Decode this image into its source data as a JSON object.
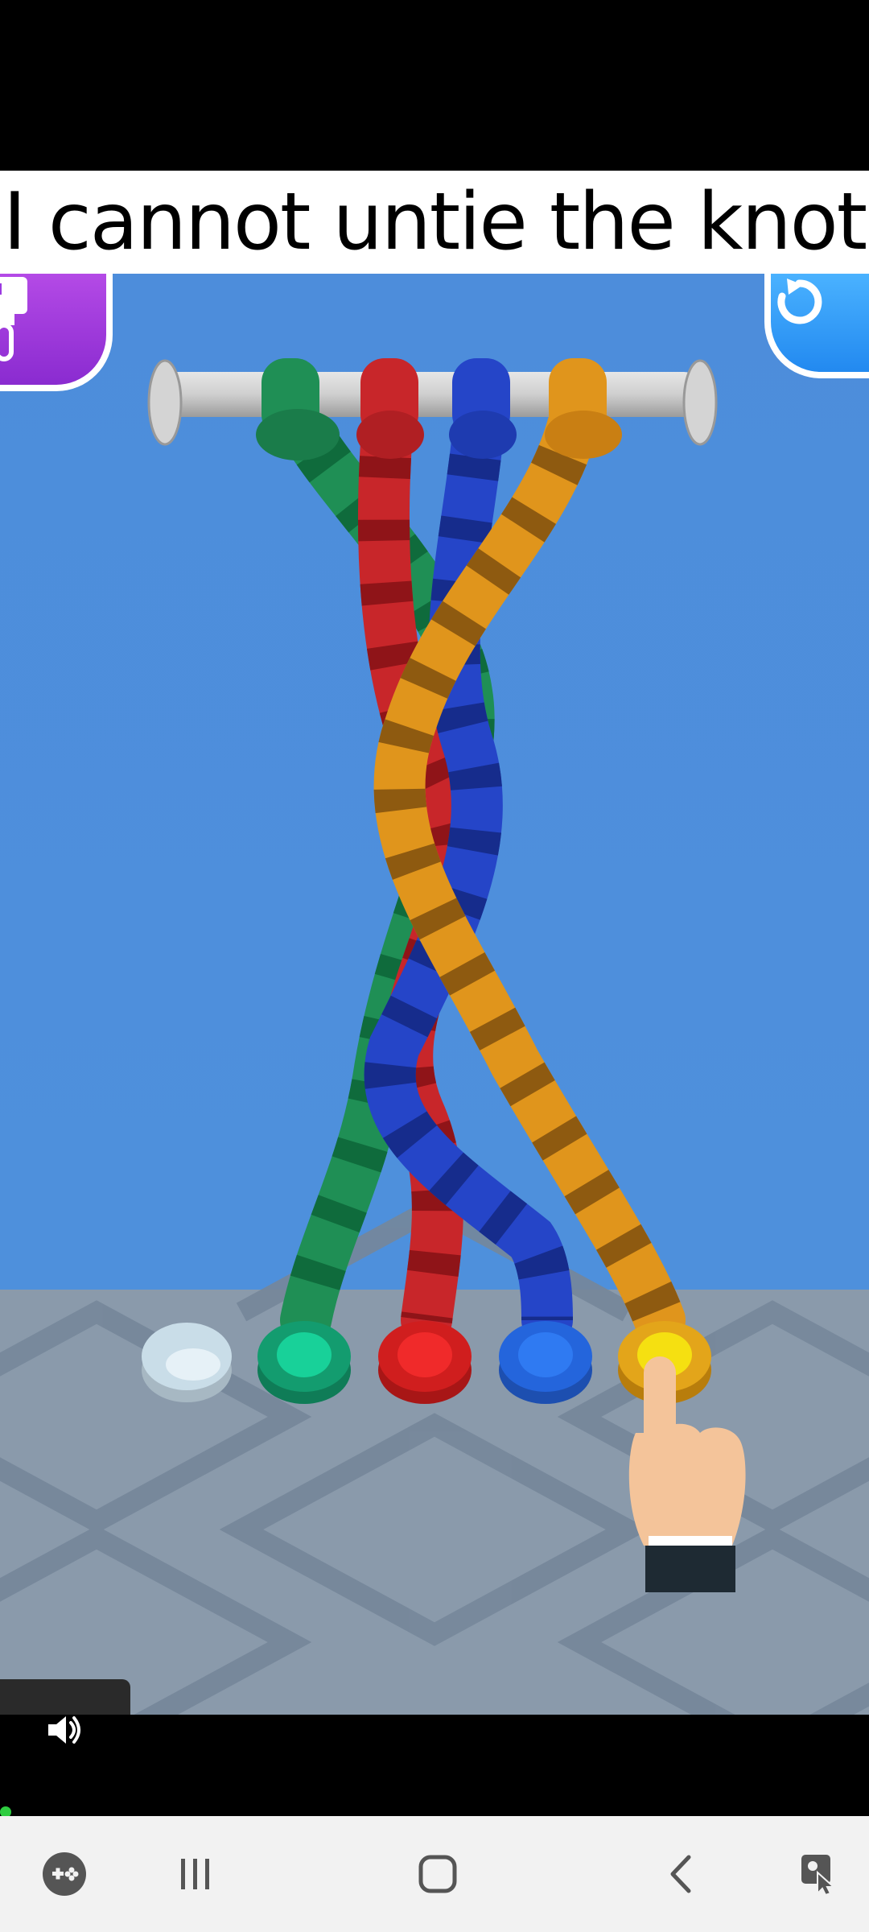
{
  "caption": {
    "text": "I cannot untie the knot"
  },
  "game": {
    "paint_button": {
      "icon": "paintbrush-icon",
      "color": "#9b3ae0"
    },
    "restart_button": {
      "icon": "restart-icon",
      "color": "#2d96f5"
    },
    "ropes": [
      {
        "name": "green",
        "color": "#1f8f55"
      },
      {
        "name": "red",
        "color": "#c8262a"
      },
      {
        "name": "blue",
        "color": "#2545c8"
      },
      {
        "name": "orange",
        "color": "#e0951c"
      }
    ],
    "pegs": [
      {
        "name": "white",
        "color": "#c9dde8"
      },
      {
        "name": "green",
        "color": "#18d199"
      },
      {
        "name": "red",
        "color": "#f02a2a"
      },
      {
        "name": "blue",
        "color": "#2f7af2"
      },
      {
        "name": "yellow",
        "color": "#f5e011"
      }
    ],
    "hint": {
      "icon": "pointing-hand-icon"
    }
  },
  "video": {
    "sound_icon": "speaker-icon"
  },
  "navigation": {
    "items": [
      {
        "icon": "game-launcher-icon"
      },
      {
        "icon": "recent-apps-icon"
      },
      {
        "icon": "home-icon"
      },
      {
        "icon": "back-icon"
      },
      {
        "icon": "accessibility-icon"
      }
    ]
  }
}
